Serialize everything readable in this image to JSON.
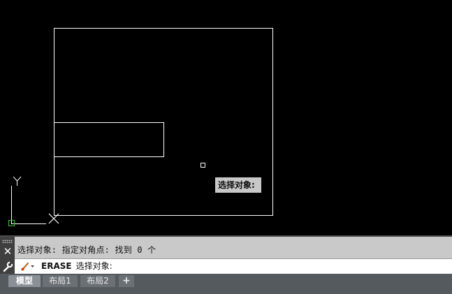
{
  "canvas": {
    "tooltip": "选择对象:",
    "ucs_y_label": "Y"
  },
  "command_line": {
    "history": "选择对象: 指定对角点: 找到 0 个",
    "command_name": "ERASE",
    "prompt": "选择对象:",
    "close_label": "✕"
  },
  "tabs": {
    "model": "模型",
    "layout1": "布局1",
    "layout2": "布局2",
    "add": "+"
  },
  "icons": {
    "close": "close-icon",
    "wrench": "wrench-icon",
    "brush": "command-brush-icon",
    "crosshair": "crosshair-cursor-icon",
    "ucs": "ucs-icon",
    "pickbox": "pickbox-icon"
  },
  "colors": {
    "canvas_background": "#000000",
    "drawing_lines": "#ffffff",
    "ucs_origin": "#33cc33",
    "command_panel": "#c9c9c9",
    "tab_bar": "#555a5f"
  }
}
